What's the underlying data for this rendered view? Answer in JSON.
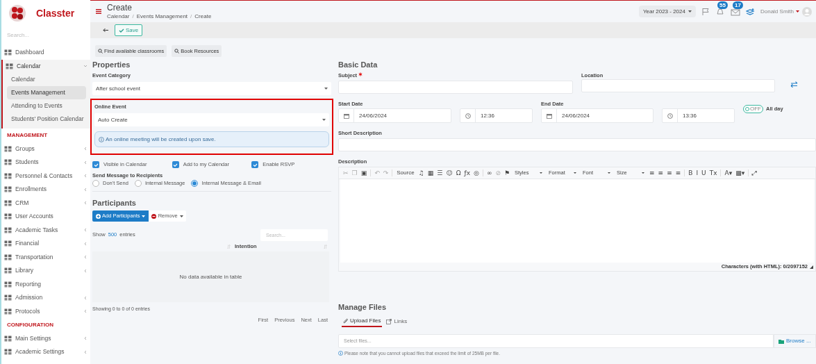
{
  "sidebar": {
    "brand": "Classter",
    "search_placeholder": "Search...",
    "items": [
      {
        "kind": "item",
        "label": "Dashboard"
      },
      {
        "kind": "item",
        "label": "Calendar",
        "expanded": true,
        "children": [
          {
            "label": "Calendar",
            "selected": false
          },
          {
            "label": "Events Management",
            "selected": true
          },
          {
            "label": "Attending to Events",
            "selected": false
          },
          {
            "label": "Students' Position Calendar",
            "selected": false
          }
        ]
      },
      {
        "kind": "heading",
        "label": "MANAGEMENT"
      },
      {
        "kind": "item",
        "label": "Groups",
        "expanded": false
      },
      {
        "kind": "item",
        "label": "Students",
        "expanded": false
      },
      {
        "kind": "item",
        "label": "Personnel & Contacts",
        "expanded": false
      },
      {
        "kind": "item",
        "label": "Enrollments",
        "expanded": false
      },
      {
        "kind": "item",
        "label": "CRM",
        "expanded": false
      },
      {
        "kind": "item",
        "label": "User Accounts"
      },
      {
        "kind": "item",
        "label": "Academic Tasks",
        "expanded": false
      },
      {
        "kind": "item",
        "label": "Financial",
        "expanded": false
      },
      {
        "kind": "item",
        "label": "Transportation",
        "expanded": false
      },
      {
        "kind": "item",
        "label": "Library",
        "expanded": false
      },
      {
        "kind": "item",
        "label": "Reporting"
      },
      {
        "kind": "item",
        "label": "Admission",
        "expanded": false
      },
      {
        "kind": "item",
        "label": "Protocols",
        "expanded": false
      },
      {
        "kind": "heading",
        "label": "CONFIGURATION"
      },
      {
        "kind": "item",
        "label": "Main Settings",
        "expanded": false
      },
      {
        "kind": "item",
        "label": "Academic Settings",
        "expanded": false
      }
    ]
  },
  "header": {
    "title": "Create",
    "breadcrumb": [
      "Calendar",
      "Events Management",
      "Create"
    ],
    "breadcrumb_separator": "/",
    "year": "Year 2023 - 2024",
    "notifications": "55",
    "messages": "17",
    "user": "Donald Smith"
  },
  "toolbar": {
    "save": "Save"
  },
  "actions": [
    "Find available classrooms",
    "Book Resources"
  ],
  "properties": {
    "heading": "Properties",
    "event_category": {
      "label": "Event Category",
      "value": "After school event"
    },
    "online_event": {
      "label": "Online Event",
      "value": "Auto Create",
      "info": "An online meeting will be created upon save."
    },
    "checkboxes": [
      {
        "label": "Visible in Calendar",
        "checked": true
      },
      {
        "label": "Add to my Calendar",
        "checked": true
      },
      {
        "label": "Enable RSVP",
        "checked": true
      }
    ],
    "send_message": {
      "label": "Send Message to Recipients",
      "options": [
        {
          "label": "Don't Send",
          "selected": false
        },
        {
          "label": "Internal Message",
          "selected": false
        },
        {
          "label": "Internal Message & Email",
          "selected": true
        }
      ]
    }
  },
  "participants": {
    "heading": "Participants",
    "add": "Add Participants",
    "remove": "Remove",
    "show": "Show",
    "page_size": "500",
    "entries": "entries",
    "search_placeholder": "Search...",
    "columns": [
      "Intention"
    ],
    "empty": "No data available in table",
    "info": "Showing 0 to 0 of 0 entries",
    "pager": [
      "First",
      "Previous",
      "Next",
      "Last"
    ]
  },
  "basic_data": {
    "heading": "Basic Data",
    "subject": {
      "label": "Subject",
      "required": true
    },
    "location": {
      "label": "Location"
    },
    "start": {
      "label": "Start Date",
      "date": "24/06/2024",
      "time": "12:36"
    },
    "end": {
      "label": "End Date",
      "date": "24/06/2024",
      "time": "13:36"
    },
    "all_day": {
      "label": "All day",
      "on": false,
      "toggle_text": "OFF"
    },
    "short_description": {
      "label": "Short Description"
    },
    "description": {
      "label": "Description"
    },
    "editor_toolbar": [
      {
        "kind": "glyph",
        "text": "✂",
        "disabled": true
      },
      {
        "kind": "glyph",
        "text": "❐",
        "disabled": true
      },
      {
        "kind": "glyph",
        "text": "▣",
        "disabled": false
      },
      {
        "kind": "sep"
      },
      {
        "kind": "glyph",
        "text": "↶",
        "disabled": true
      },
      {
        "kind": "glyph",
        "text": "↷",
        "disabled": true
      },
      {
        "kind": "sep"
      },
      {
        "kind": "button",
        "text": "Source"
      },
      {
        "kind": "glyph",
        "text": "♫",
        "disabled": false
      },
      {
        "kind": "glyph",
        "text": "▦",
        "disabled": false
      },
      {
        "kind": "glyph",
        "text": "☰",
        "disabled": false
      },
      {
        "kind": "glyph",
        "text": "☺",
        "disabled": false
      },
      {
        "kind": "glyph",
        "text": "Ω",
        "disabled": false
      },
      {
        "kind": "glyph",
        "text": "ƒx",
        "disabled": false
      },
      {
        "kind": "glyph",
        "text": "◎",
        "disabled": false
      },
      {
        "kind": "sep"
      },
      {
        "kind": "glyph",
        "text": "∞",
        "disabled": false
      },
      {
        "kind": "glyph",
        "text": "⊘",
        "disabled": true
      },
      {
        "kind": "glyph",
        "text": "⚑",
        "disabled": false
      },
      {
        "kind": "dropdown",
        "text": "Styles"
      },
      {
        "kind": "dropdown",
        "text": "Format"
      },
      {
        "kind": "dropdown",
        "text": "Font"
      },
      {
        "kind": "dropdown",
        "text": "Size"
      },
      {
        "kind": "glyph",
        "text": "≡",
        "disabled": false
      },
      {
        "kind": "glyph",
        "text": "≡",
        "disabled": false
      },
      {
        "kind": "glyph",
        "text": "≡",
        "disabled": false
      },
      {
        "kind": "glyph",
        "text": "≡",
        "disabled": false
      },
      {
        "kind": "sep"
      },
      {
        "kind": "glyph",
        "text": "B",
        "disabled": false
      },
      {
        "kind": "glyph",
        "text": "I",
        "disabled": false
      },
      {
        "kind": "glyph",
        "text": "U",
        "disabled": false
      },
      {
        "kind": "glyph",
        "text": "Tx",
        "disabled": false
      },
      {
        "kind": "sep"
      },
      {
        "kind": "glyph",
        "text": "A▾",
        "disabled": false
      },
      {
        "kind": "glyph",
        "text": "▩▾",
        "disabled": false
      },
      {
        "kind": "sep"
      },
      {
        "kind": "glyph",
        "text": "⤢",
        "disabled": false
      }
    ],
    "char_count": "Characters (with HTML): 0/2097152"
  },
  "files": {
    "heading": "Manage Files",
    "tabs": [
      {
        "label": "Upload Files",
        "selected": true
      },
      {
        "label": "Links",
        "selected": false
      }
    ],
    "placeholder": "Select files...",
    "browse": "Browse ...",
    "note": "Please note that you cannot upload files that exceed the limit of 25MB per file."
  }
}
